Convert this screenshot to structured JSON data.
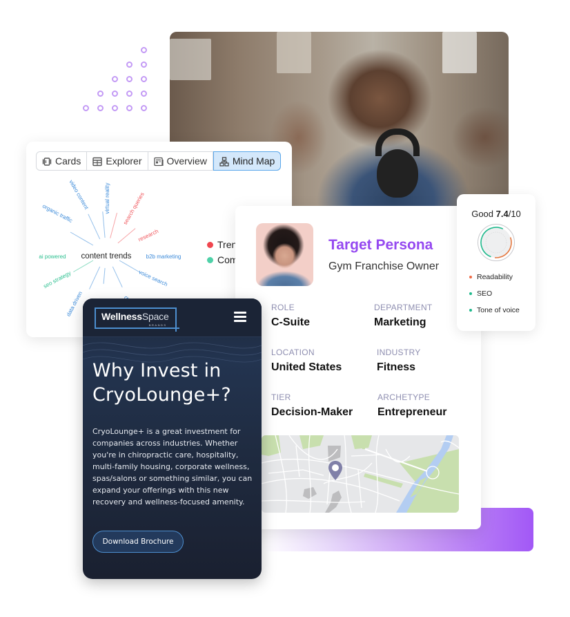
{
  "mind_map": {
    "tabs": [
      {
        "label": "Cards",
        "icon": "cards-icon",
        "active": false
      },
      {
        "label": "Explorer",
        "icon": "table-icon",
        "active": false
      },
      {
        "label": "Overview",
        "icon": "overview-icon",
        "active": false
      },
      {
        "label": "Mind Map",
        "icon": "mind-map-icon",
        "active": true
      }
    ],
    "center_label": "content trends",
    "nodes": [
      {
        "label": "virtual reality",
        "color": "#3b8ad9"
      },
      {
        "label": "video content",
        "color": "#3b8ad9"
      },
      {
        "label": "organic traffic",
        "color": "#3b8ad9"
      },
      {
        "label": "search queries",
        "color": "#f0575d"
      },
      {
        "label": "research",
        "color": "#f0575d"
      },
      {
        "label": "ai powered",
        "color": "#2bbf8f"
      },
      {
        "label": "b2b marketing",
        "color": "#3b8ad9"
      },
      {
        "label": "seo strategy",
        "color": "#2bbf8f"
      },
      {
        "label": "data driven",
        "color": "#3b8ad9"
      },
      {
        "label": "s",
        "color": "#3b8ad9"
      },
      {
        "label": "dat",
        "color": "#3b8ad9"
      },
      {
        "label": "voice search",
        "color": "#3b8ad9"
      }
    ],
    "legend": [
      {
        "label": "Tren",
        "color": "#f0464f"
      },
      {
        "label": "Com",
        "color": "#4fd1a8"
      }
    ]
  },
  "persona": {
    "title": "Target Persona",
    "subtitle": "Gym Franchise Owner",
    "fields": [
      {
        "label": "ROLE",
        "value": "C-Suite"
      },
      {
        "label": "DEPARTMENT",
        "value": "Marketing"
      },
      {
        "label": "LOCATION",
        "value": "United States"
      },
      {
        "label": "INDUSTRY",
        "value": "Fitness"
      },
      {
        "label": "TIER",
        "value": "Decision-Maker"
      },
      {
        "label": "ARCHETYPE",
        "value": "Entrepreneur"
      }
    ],
    "accent_color": "#9549f0"
  },
  "score": {
    "prefix": "Good ",
    "value": "7.4",
    "suffix": "/10",
    "value_fraction": 0.74,
    "items": [
      {
        "label": "Readability",
        "color": "#f06a45"
      },
      {
        "label": "SEO",
        "color": "#1fb98c"
      },
      {
        "label": "Tone of voice",
        "color": "#1fb98c"
      }
    ]
  },
  "wellness": {
    "logo_main": "Wellness",
    "logo_accent": "Space",
    "logo_sub": "BRANDS",
    "heading": "Why Invest in CryoLounge+?",
    "body": "CryoLounge+ is a great investment for companies across industries. Whether you're in chiropractic care, hospitality, multi-family housing, corporate wellness, spas/salons or something similar, you can expand your offerings with this new recovery and wellness-focused amenity.",
    "button_label": "Download Brochure"
  }
}
